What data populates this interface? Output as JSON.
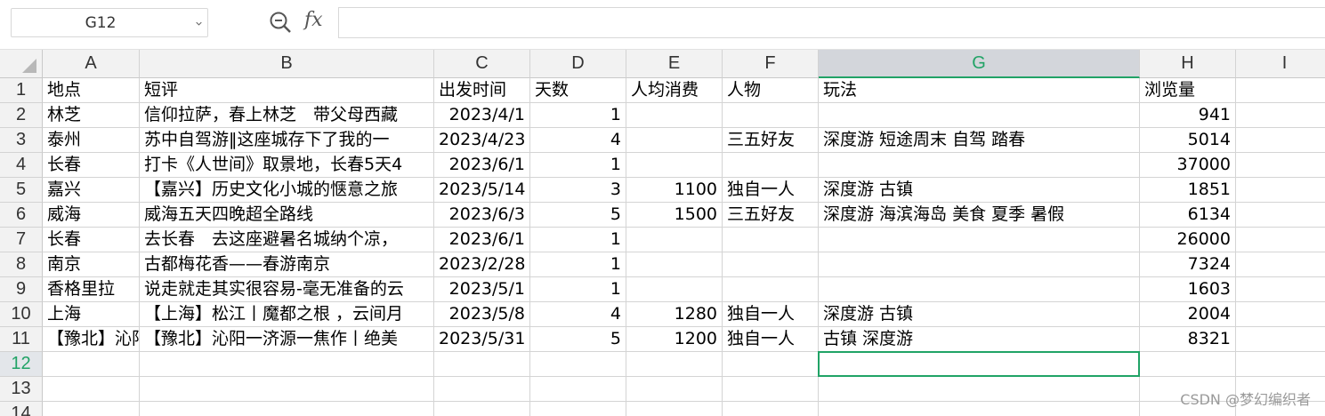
{
  "formula_bar": {
    "cell_ref": "G12",
    "formula": ""
  },
  "columns": [
    {
      "label": "A"
    },
    {
      "label": "B"
    },
    {
      "label": "C"
    },
    {
      "label": "D"
    },
    {
      "label": "E"
    },
    {
      "label": "F"
    },
    {
      "label": "G"
    },
    {
      "label": "H"
    },
    {
      "label": "I"
    }
  ],
  "rows": [
    "1",
    "2",
    "3",
    "4",
    "5",
    "6",
    "7",
    "8",
    "9",
    "10",
    "11",
    "12",
    "13",
    "14"
  ],
  "selected_cell": {
    "row": "12",
    "col": "G"
  },
  "data": [
    [
      "地点",
      "短评",
      "出发时间",
      "天数",
      "人均消费",
      "人物",
      "玩法",
      "浏览量",
      ""
    ],
    [
      "林芝",
      "信仰拉萨，春上林芝　带父母西藏",
      "2023/4/1",
      "1",
      "",
      "",
      "",
      "941",
      ""
    ],
    [
      "泰州",
      "苏中自驾游‖这座城存下了我的一",
      "2023/4/23",
      "4",
      "",
      "三五好友",
      "深度游 短途周末 自驾 踏春",
      "5014",
      ""
    ],
    [
      "长春",
      "打卡《人世间》取景地，长春5天4",
      "2023/6/1",
      "1",
      "",
      "",
      "",
      "37000",
      ""
    ],
    [
      "嘉兴",
      "【嘉兴】历史文化小城的惬意之旅",
      "2023/5/14",
      "3",
      "1100",
      "独自一人",
      "深度游 古镇",
      "1851",
      ""
    ],
    [
      "威海",
      "威海五天四晚超全路线",
      "2023/6/3",
      "5",
      "1500",
      "三五好友",
      "深度游 海滨海岛 美食 夏季 暑假",
      "6134",
      ""
    ],
    [
      "长春",
      "去长春　去这座避暑名城纳个凉，",
      "2023/6/1",
      "1",
      "",
      "",
      "",
      "26000",
      ""
    ],
    [
      "南京",
      "古都梅花香——春游南京",
      "2023/2/28",
      "1",
      "",
      "",
      "",
      "7324",
      ""
    ],
    [
      "香格里拉",
      "说走就走其实很容易-毫无准备的云",
      "2023/5/1",
      "1",
      "",
      "",
      "",
      "1603",
      ""
    ],
    [
      "上海",
      "【上海】松江丨魔都之根 ，云间月",
      "2023/5/8",
      "4",
      "1280",
      "独自一人",
      "深度游 古镇",
      "2004",
      ""
    ],
    [
      "【豫北】沁阳",
      "【豫北】沁阳一济源一焦作丨绝美",
      "2023/5/31",
      "5",
      "1200",
      "独自一人",
      "古镇 深度游",
      "8321",
      ""
    ],
    [
      "",
      "",
      "",
      "",
      "",
      "",
      "",
      "",
      ""
    ],
    [
      "",
      "",
      "",
      "",
      "",
      "",
      "",
      "",
      ""
    ],
    [
      "",
      "",
      "",
      "",
      "",
      "",
      "",
      "",
      ""
    ]
  ],
  "watermark": "CSDN @梦幻编织者",
  "colors": {
    "accent": "#21a366",
    "header_bg": "#f2f2f2",
    "selected_header_bg": "#d3d6db"
  }
}
